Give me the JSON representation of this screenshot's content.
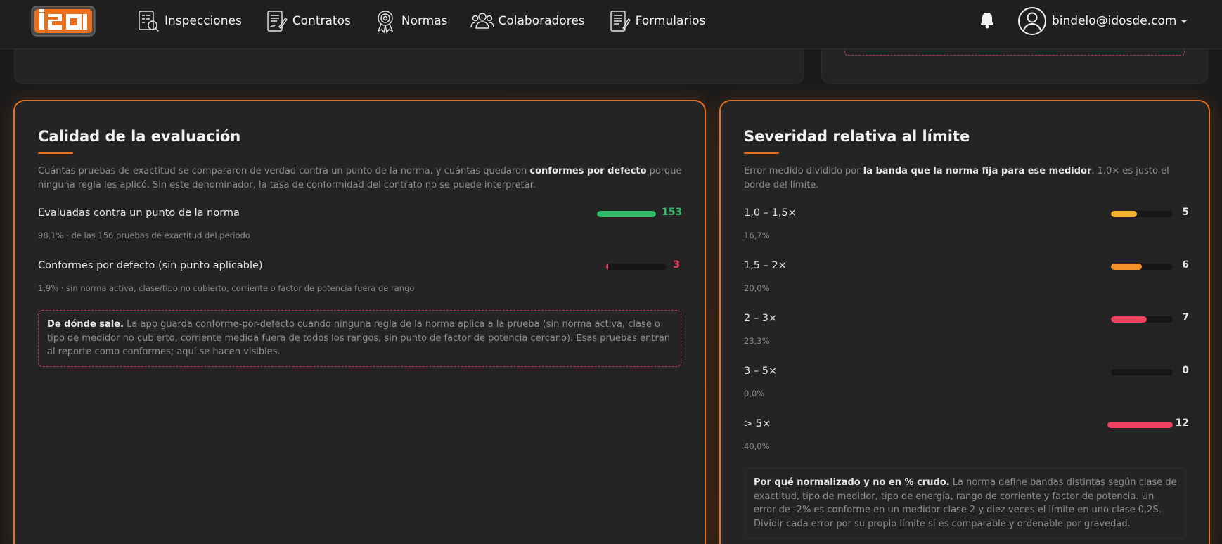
{
  "colors": {
    "accent": "#e8701c",
    "green": "#2ebd6b",
    "red": "#f0405f",
    "yellow": "#f6b426",
    "orange": "#f3922a"
  },
  "nav": {
    "items": [
      {
        "label": "Inspecciones",
        "icon": "inspection-icon"
      },
      {
        "label": "Contratos",
        "icon": "contract-icon"
      },
      {
        "label": "Normas",
        "icon": "award-icon"
      },
      {
        "label": "Colaboradores",
        "icon": "users-icon"
      },
      {
        "label": "Formularios",
        "icon": "form-icon"
      }
    ],
    "user_email": "bindelo@idosde.com"
  },
  "quality": {
    "title": "Calidad de la evaluación",
    "desc_pre": "Cuántas pruebas de exactitud se compararon de verdad contra un punto de la norma, y cuántas quedaron ",
    "desc_bold": "conformes por defecto",
    "desc_post": " porque ninguna regla les aplicó. Sin este denominador, la tasa de conformidad del contrato no se puede interpretar.",
    "rows": [
      {
        "label": "Evaluadas contra un punto de la norma",
        "value": "153",
        "fraction": 0.981,
        "color": "#2ebd6b",
        "sub": "98,1% · de las 156 pruebas de exactitud del periodo"
      },
      {
        "label": "Conformes por defecto (sin punto aplicable)",
        "value": "3",
        "fraction": 0.019,
        "color": "#f0405f",
        "sub": "1,9% · sin norma activa, clase/tipo no cubierto, corriente o factor de potencia fuera de rango"
      }
    ],
    "note_bold": "De dónde sale.",
    "note_text": " La app guarda conforme-por-defecto cuando ninguna regla de la norma aplica a la prueba (sin norma activa, clase o tipo de medidor no cubierto, corriente medida fuera de todos los rangos, sin punto de factor de potencia cercano). Esas pruebas entran al reporte como conformes; aquí se hacen visibles."
  },
  "severity": {
    "title": "Severidad relativa al límite",
    "desc_pre": "Error medido dividido por ",
    "desc_bold": "la banda que la norma fija para ese medidor",
    "desc_post": ". 1,0× es justo el borde del límite.",
    "rows": [
      {
        "label": "1,0 – 1,5×",
        "value": "5",
        "fraction": 0.417,
        "color": "#f6b426",
        "sub": "16,7%"
      },
      {
        "label": "1,5 – 2×",
        "value": "6",
        "fraction": 0.5,
        "color": "#f3922a",
        "sub": "20,0%"
      },
      {
        "label": "2 – 3×",
        "value": "7",
        "fraction": 0.583,
        "color": "#f0405f",
        "sub": "23,3%"
      },
      {
        "label": "3 – 5×",
        "value": "0",
        "fraction": 0,
        "color": "#f0405f",
        "sub": "0,0%"
      },
      {
        "label": "> 5×",
        "value": "12",
        "fraction": 1.0,
        "color": "#f0405f",
        "sub": "40,0%"
      }
    ],
    "note_bold": "Por qué normalizado y no en % crudo.",
    "note_text": " La norma define bandas distintas según clase de exactitud, tipo de medidor, tipo de energía, rango de corriente y factor de potencia. Un error de -2% es conforme en un medidor clase 2 y diez veces el límite en uno clase 0,2S. Dividir cada error por su propio límite sí es comparable y ordenable por gravedad."
  }
}
